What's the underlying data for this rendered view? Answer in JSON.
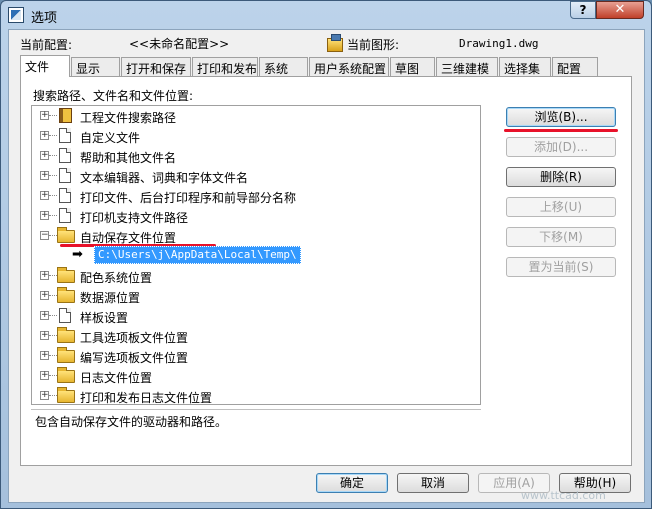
{
  "window": {
    "title": "选项",
    "help_label": "?",
    "close_label": "✕"
  },
  "header": {
    "current_profile_label": "当前配置:",
    "current_profile_value": "<<未命名配置>>",
    "current_drawing_label": "当前图形:",
    "current_drawing_value": "Drawing1.dwg"
  },
  "tabs": [
    {
      "label": "文件",
      "active": true
    },
    {
      "label": "显示"
    },
    {
      "label": "打开和保存"
    },
    {
      "label": "打印和发布"
    },
    {
      "label": "系统"
    },
    {
      "label": "用户系统配置"
    },
    {
      "label": "草图"
    },
    {
      "label": "三维建模"
    },
    {
      "label": "选择集"
    },
    {
      "label": "配置"
    }
  ],
  "panel": {
    "tree_title": "搜索路径、文件名和文件位置:",
    "tree_items": [
      {
        "label": "工程文件搜索路径",
        "icon": "book-icon"
      },
      {
        "label": "自定义文件",
        "icon": "document-icon"
      },
      {
        "label": "帮助和其他文件名",
        "icon": "document-icon"
      },
      {
        "label": "文本编辑器、词典和字体文件名",
        "icon": "document-icon"
      },
      {
        "label": "打印文件、后台打印程序和前导部分名称",
        "icon": "document-icon"
      },
      {
        "label": "打印机支持文件路径",
        "icon": "document-icon"
      },
      {
        "label": "自动保存文件位置",
        "icon": "folder-open-icon",
        "expanded": true
      },
      {
        "label": "配色系统位置",
        "icon": "folder-icon"
      },
      {
        "label": "数据源位置",
        "icon": "folder-icon"
      },
      {
        "label": "样板设置",
        "icon": "document-icon"
      },
      {
        "label": "工具选项板文件位置",
        "icon": "folder-icon"
      },
      {
        "label": "编写选项板文件位置",
        "icon": "folder-icon"
      },
      {
        "label": "日志文件位置",
        "icon": "folder-icon"
      },
      {
        "label": "打印和发布日志文件位置",
        "icon": "folder-icon"
      }
    ],
    "autosave_path": "C:\\Users\\j\\AppData\\Local\\Temp\\",
    "description": "包含自动保存文件的驱动器和路径。",
    "expander_symbol": "+",
    "collapse_symbol": "−",
    "arrow_symbol": "➡"
  },
  "side_buttons": {
    "browse": "浏览(B)...",
    "add": "添加(D)...",
    "remove": "删除(R)",
    "move_up": "上移(U)",
    "move_down": "下移(M)",
    "set_current": "置为当前(S)"
  },
  "footer": {
    "ok": "确定",
    "cancel": "取消",
    "apply": "应用(A)",
    "help": "帮助(H)"
  },
  "watermark": "www.ttcad.com",
  "colors": {
    "annotation_red": "#e8122a",
    "selection_blue": "#3399ff"
  }
}
